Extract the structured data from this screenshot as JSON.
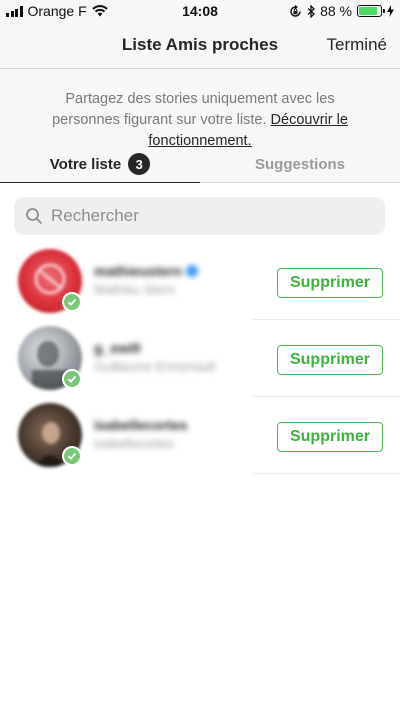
{
  "status_bar": {
    "carrier": "Orange F",
    "time": "14:08",
    "battery_percent": "88 %",
    "battery_level": 0.88,
    "icons": [
      "signal-icon",
      "wifi-icon",
      "rotation-lock-icon",
      "bluetooth-icon",
      "battery-icon",
      "charging-icon"
    ]
  },
  "header": {
    "title": "Liste Amis proches",
    "done_label": "Terminé"
  },
  "intro": {
    "text": "Partagez des stories uniquement avec les personnes figurant sur votre liste.",
    "link_text": "Découvrir le fonctionnement."
  },
  "tabs": [
    {
      "label": "Votre liste",
      "badge": "3",
      "active": true
    },
    {
      "label": "Suggestions",
      "active": false
    }
  ],
  "search": {
    "placeholder": "Rechercher",
    "icon": "search-icon"
  },
  "friends": [
    {
      "username": "mathieustern",
      "full_name": "Mathieu Stern",
      "verified": true,
      "action_label": "Supprimer",
      "avatar_color": "#d9303a"
    },
    {
      "username": "g_ewill",
      "full_name": "Guillaume Ermenault",
      "verified": false,
      "action_label": "Supprimer",
      "avatar_color": "#8a9095"
    },
    {
      "username": "isabellecortes",
      "full_name": "isabellecortes",
      "verified": false,
      "action_label": "Supprimer",
      "avatar_color": "#3b2f2a"
    }
  ],
  "colors": {
    "accent_green": "#3eb13e",
    "badge_bg": "#262626",
    "header_bg": "#f7f7f7",
    "verified_blue": "#3897f0"
  }
}
